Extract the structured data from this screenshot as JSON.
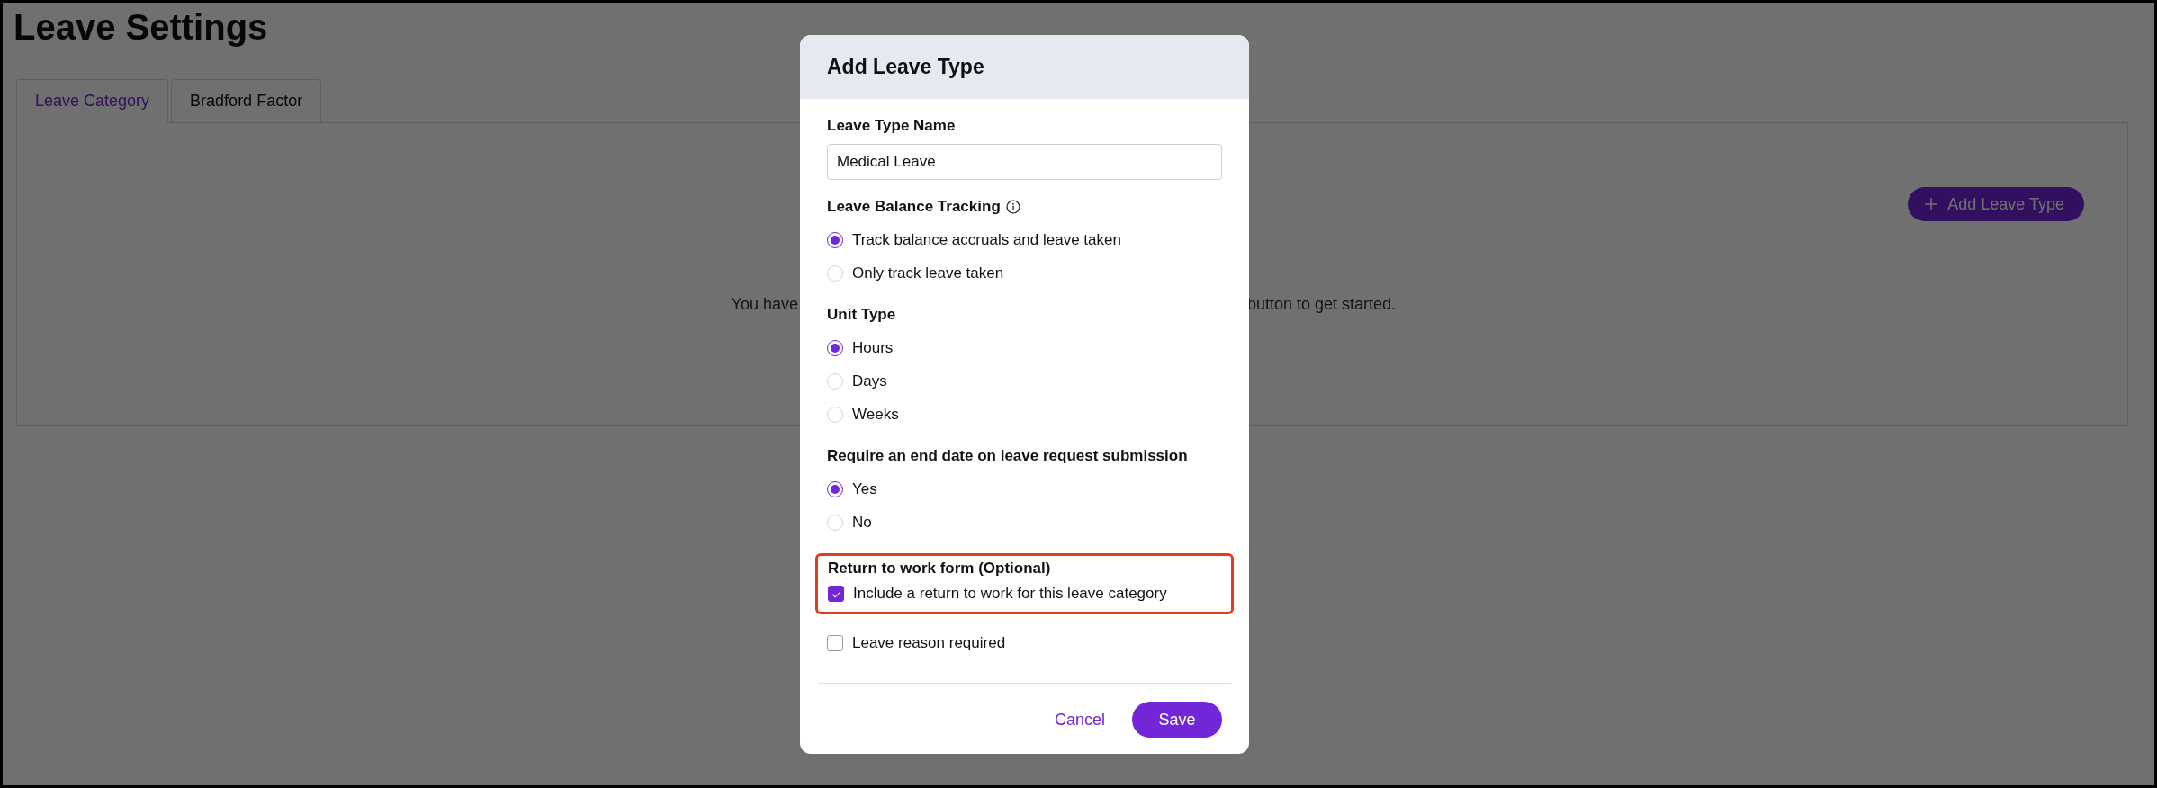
{
  "page": {
    "title": "Leave Settings"
  },
  "tabs": [
    {
      "label": "Leave Category",
      "selected": true
    },
    {
      "label": "Bradford Factor",
      "selected": false
    }
  ],
  "add_button": {
    "label": "Add Leave Type"
  },
  "empty_state": {
    "text_start": "You have",
    "text_end": "button to get started."
  },
  "dialog": {
    "title": "Add Leave Type",
    "fields": [
      {
        "kind": "text",
        "label": "Leave Type Name",
        "value": "Medical Leave"
      },
      {
        "kind": "radio",
        "label": "Leave Balance Tracking",
        "info": true,
        "options": [
          {
            "label": "Track balance accruals and leave taken",
            "selected": true
          },
          {
            "label": "Only track leave taken",
            "selected": false
          }
        ]
      },
      {
        "kind": "radio",
        "label": "Unit Type",
        "options": [
          {
            "label": "Hours",
            "selected": true
          },
          {
            "label": "Days",
            "selected": false
          },
          {
            "label": "Weeks",
            "selected": false
          }
        ]
      },
      {
        "kind": "radio",
        "label": "Require an end date on leave request submission",
        "options": [
          {
            "label": "Yes",
            "selected": true
          },
          {
            "label": "No",
            "selected": false
          }
        ]
      },
      {
        "kind": "checkbox_group",
        "label": "Return to work form (Optional)",
        "highlighted": true,
        "options": [
          {
            "label": "Include a return to work for this leave category",
            "checked": true
          }
        ]
      },
      {
        "kind": "checkbox",
        "label": "Leave reason required",
        "checked": false
      }
    ],
    "cancel": "Cancel",
    "save": "Save"
  }
}
